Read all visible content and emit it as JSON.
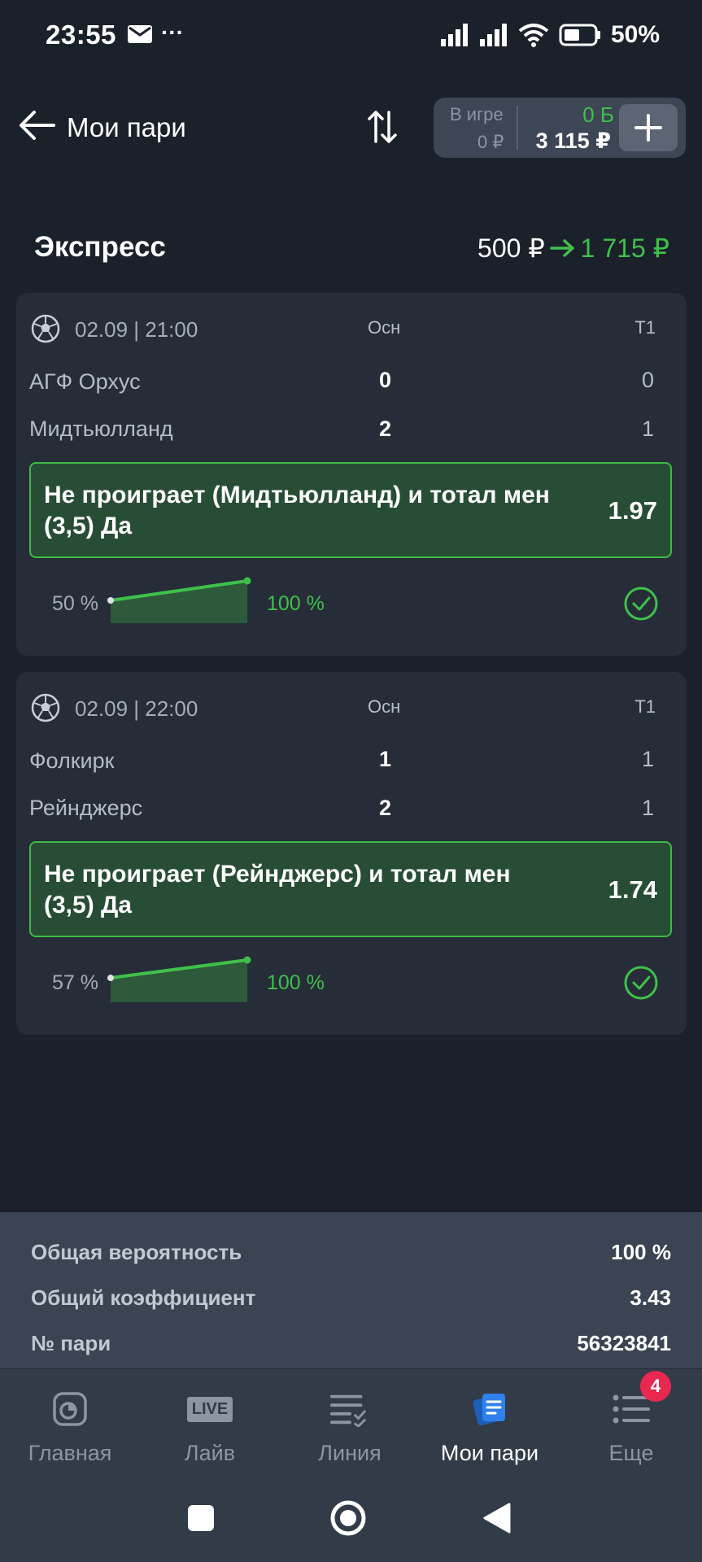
{
  "status_bar": {
    "time": "23:55",
    "mail_icon": "mail-icon",
    "more_indicator": "···",
    "battery": "50%"
  },
  "header": {
    "title": "Мои пари",
    "balance": {
      "in_game_label": "В игре",
      "in_game_value": "0 ₽",
      "bonus": "0 Б",
      "money": "3 115 ₽"
    }
  },
  "express": {
    "title": "Экспресс",
    "stake": "500 ₽",
    "payout": "1 715 ₽"
  },
  "events": [
    {
      "datetime": "02.09 | 21:00",
      "col_main": "Осн",
      "col_t1": "Т1",
      "team1": "АГФ Орхус",
      "team1_main": "0",
      "team1_t1": "0",
      "team2": "Мидтьюлланд",
      "team2_main": "2",
      "team2_t1": "1",
      "bet": "Не проиграет (Мидтьюлланд) и тотал мен (3,5) Да",
      "odds": "1.97",
      "prob_start": "50 %",
      "prob_end": "100 %",
      "prob_start_value": 50,
      "prob_end_value": 100
    },
    {
      "datetime": "02.09 | 22:00",
      "col_main": "Осн",
      "col_t1": "Т1",
      "team1": "Фолкирк",
      "team1_main": "1",
      "team1_t1": "1",
      "team2": "Рейнджерс",
      "team2_main": "2",
      "team2_t1": "1",
      "bet": "Не проиграет (Рейнджерс) и тотал мен (3,5) Да",
      "odds": "1.74",
      "prob_start": "57 %",
      "prob_end": "100 %",
      "prob_start_value": 57,
      "prob_end_value": 100
    }
  ],
  "summary": {
    "probability_label": "Общая вероятность",
    "probability_value": "100 %",
    "coefficient_label": "Общий коэффициент",
    "coefficient_value": "3.43",
    "bet_number_label": "№ пари",
    "bet_number_value": "56323841"
  },
  "nav": {
    "items": [
      {
        "label": "Главная",
        "icon": "home-icon"
      },
      {
        "label": "Лайв",
        "icon": "live-icon",
        "icon_text": "LIVE"
      },
      {
        "label": "Линия",
        "icon": "line-icon"
      },
      {
        "label": "Мои пари",
        "icon": "my-bets-icon"
      },
      {
        "label": "Еще",
        "icon": "more-icon",
        "badge": "4"
      }
    ]
  },
  "colors": {
    "background": "#1b212b",
    "card": "#262d38",
    "accent_green": "#3fc04a",
    "bet_box": "#284d35",
    "badge": "#e8284f",
    "active_nav": "#2f80ed"
  }
}
